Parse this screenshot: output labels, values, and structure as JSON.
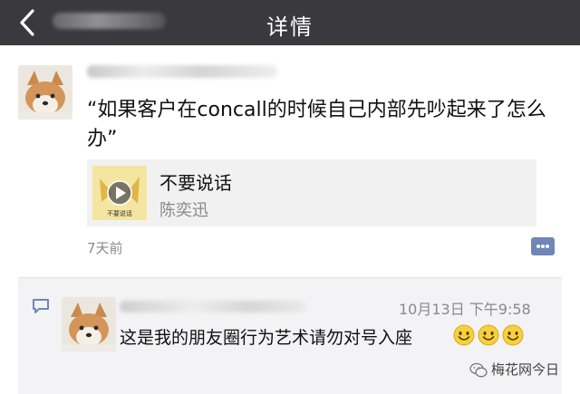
{
  "navbar": {
    "title": "详情"
  },
  "post": {
    "text": "“如果客户在concall的时候自己内部先吵起来了怎么办”",
    "share_card": {
      "title": "不要说话",
      "source": "陈奕迅",
      "thumb_caption": "不要说话"
    },
    "time": "7天前"
  },
  "comment": {
    "time": "10月13日 下午9:58",
    "text": "这是我的朋友圈行为艺术请勿对号入座",
    "emoji": [
      "smile-emoji",
      "smile-emoji",
      "smile-emoji"
    ]
  },
  "watermark": {
    "text": "梅花网今日"
  },
  "colors": {
    "navbar_bg": "#3a3a3e",
    "link_blue": "#6f86b6",
    "comment_bg": "#f3f3f5"
  }
}
